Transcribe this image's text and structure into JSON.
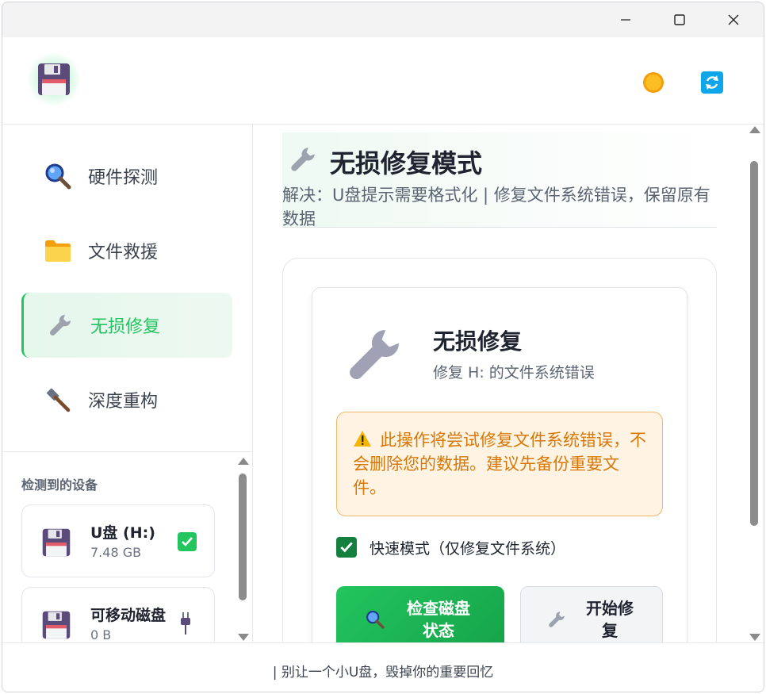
{
  "header": {
    "logo_icon": "floppy-disk-icon",
    "theme_icon": "sun-icon",
    "refresh_icon": "refresh-icon"
  },
  "sidebar": {
    "nav": [
      {
        "label": "硬件探测",
        "icon": "magnifier-icon",
        "active": false
      },
      {
        "label": "文件救援",
        "icon": "folder-icon",
        "active": false
      },
      {
        "label": "无损修复",
        "icon": "wrench-icon",
        "active": true
      },
      {
        "label": "深度重构",
        "icon": "hammer-icon",
        "active": false
      }
    ],
    "devices_title": "检测到的设备",
    "devices": [
      {
        "name": "U盘 (H:)",
        "size": "7.48 GB",
        "status_icon": "check-icon"
      },
      {
        "name": "可移动磁盘",
        "size": "0 B",
        "status_icon": "plug-icon"
      }
    ]
  },
  "main": {
    "title": "无损修复模式",
    "subtitle": "解决：U盘提示需要格式化 | 修复文件系统错误，保留原有数据",
    "card": {
      "title": "无损修复",
      "subtitle": "修复 H: 的文件系统错误",
      "warning": "此操作将尝试修复文件系统错误，不会删除您的数据。建议先备份重要文件。",
      "quick_mode_label": "快速模式（仅修复文件系统）",
      "quick_mode_checked": true,
      "check_button": "检查磁盘状态",
      "start_button": "开始修复"
    }
  },
  "footer": {
    "text": "|   别让一个小U盘，毁掉你的重要回忆"
  },
  "colors": {
    "accent": "#22c55e",
    "warning_text": "#d97706",
    "warning_bg": "#fff4e3",
    "warning_border": "#f0b86a"
  }
}
